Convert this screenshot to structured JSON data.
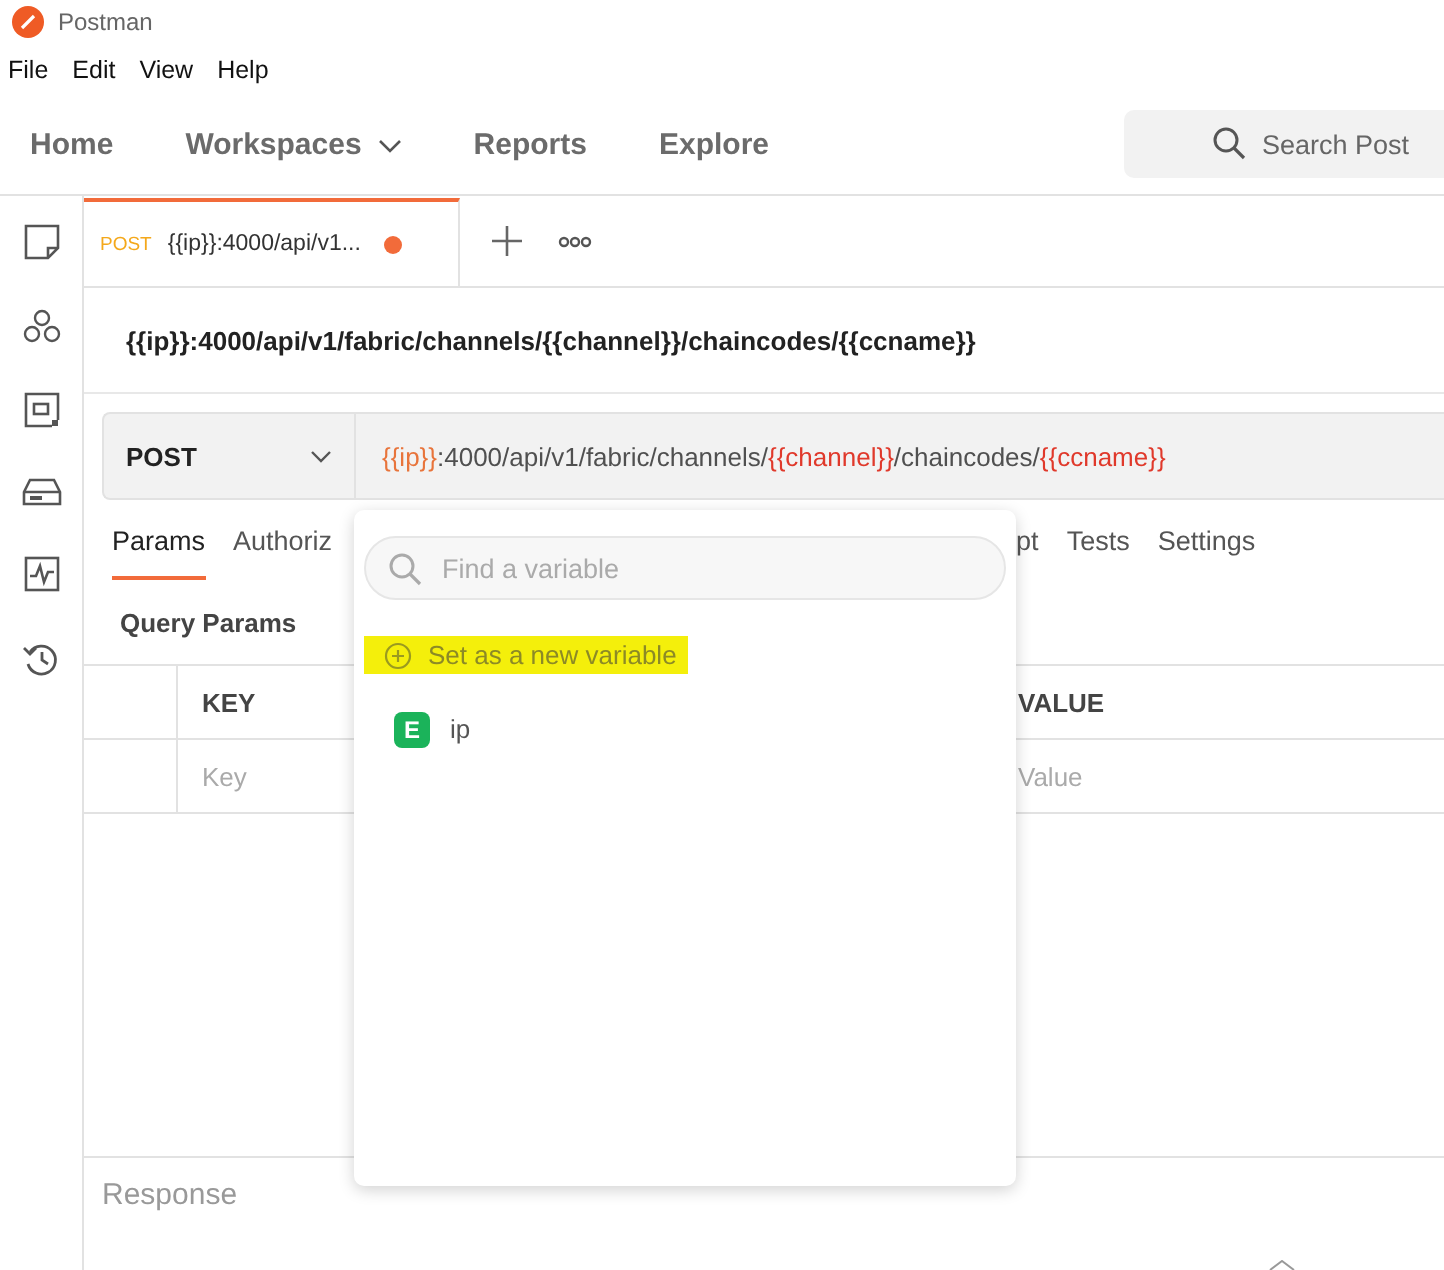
{
  "window": {
    "title": "Postman"
  },
  "menu": [
    "File",
    "Edit",
    "View",
    "Help"
  ],
  "nav": [
    {
      "label": "Home",
      "dropdown": false
    },
    {
      "label": "Workspaces",
      "dropdown": true
    },
    {
      "label": "Reports",
      "dropdown": false
    },
    {
      "label": "Explore",
      "dropdown": false
    }
  ],
  "search": {
    "placeholder": "Search Post"
  },
  "request_tab": {
    "method": "POST",
    "title": "{{ip}}:4000/api/v1...",
    "unsaved": true
  },
  "request_name": "{{ip}}:4000/api/v1/fabric/channels/{{channel}}/chaincodes/{{ccname}}",
  "method": "POST",
  "url": [
    {
      "kind": "resolved",
      "text": "{{ip}}"
    },
    {
      "kind": "text",
      "text": ":4000/api/v1/fabric/channels/"
    },
    {
      "kind": "unresolved",
      "text": "{{channel}}"
    },
    {
      "kind": "text",
      "text": "/chaincodes/"
    },
    {
      "kind": "unresolved",
      "text": "{{ccname}}"
    }
  ],
  "request_tabs_left": [
    {
      "label": "Params",
      "selected": true
    },
    {
      "label": "Authoriz",
      "selected": false
    }
  ],
  "request_tabs_right": [
    {
      "label": "pt",
      "selected": false
    },
    {
      "label": "Tests",
      "selected": false
    },
    {
      "label": "Settings",
      "selected": false
    }
  ],
  "section_title": "Query Params",
  "table": {
    "columns": [
      "KEY",
      "VALUE"
    ],
    "rows": [
      {
        "key_placeholder": "Key",
        "value_placeholder": "Value"
      }
    ]
  },
  "response": {
    "title": "Response"
  },
  "variable_popup": {
    "search_placeholder": "Find a variable",
    "action": {
      "label": "Set as a new variable",
      "highlighted": true
    },
    "variables": [
      {
        "scope": "E",
        "name": "ip"
      }
    ]
  }
}
